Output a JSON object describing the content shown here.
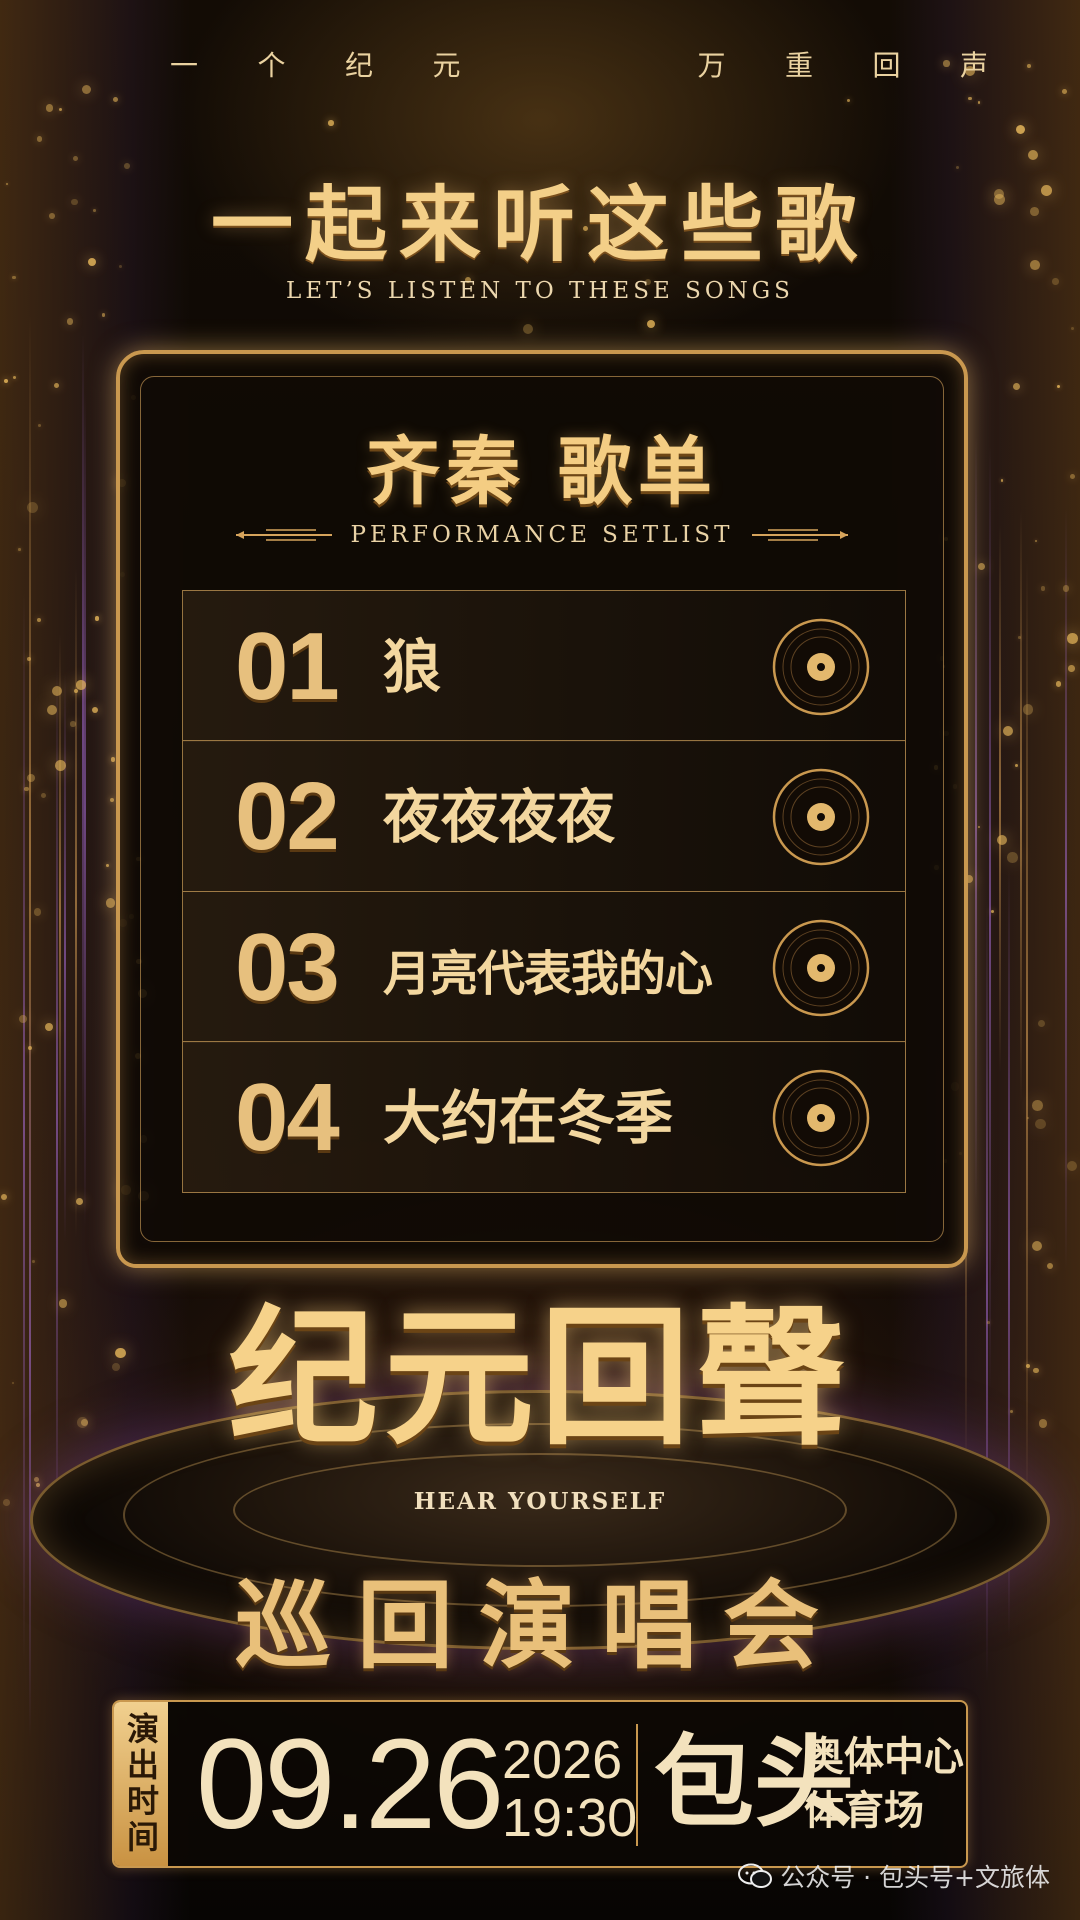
{
  "header": {
    "tagline_left": [
      "一",
      "个",
      "纪",
      "元"
    ],
    "tagline_right": [
      "万",
      "重",
      "回",
      "声"
    ],
    "headline": "一起来听这些歌",
    "sub_headline": "LET’S LISTEN TO THESE SONGS"
  },
  "setlist": {
    "title": "齐秦 歌单",
    "subtitle": "PERFORMANCE SETLIST",
    "songs": [
      {
        "number": "01",
        "title": "狼"
      },
      {
        "number": "02",
        "title": "夜夜夜夜"
      },
      {
        "number": "03",
        "title": "月亮代表我的心"
      },
      {
        "number": "04",
        "title": "大约在冬季"
      }
    ]
  },
  "logo": {
    "title": "纪元回聲",
    "english": "HEAR YOURSELF",
    "tour": "巡回演唱会"
  },
  "info": {
    "label": "演出时间",
    "date": "09.26",
    "year": "2026",
    "time": "19:30",
    "city": "包头",
    "venue_line1": "奥体中心",
    "venue_line2": "体育场"
  },
  "watermark": "公众号 · 包头号+文旅体",
  "colors": {
    "gold": "#f3cf88",
    "frame_gold": "#c9984f",
    "background": "#0a0704",
    "purple_glow": "#a05ac8"
  },
  "icons": [
    "vinyl-record-icon",
    "wechat-icon"
  ]
}
